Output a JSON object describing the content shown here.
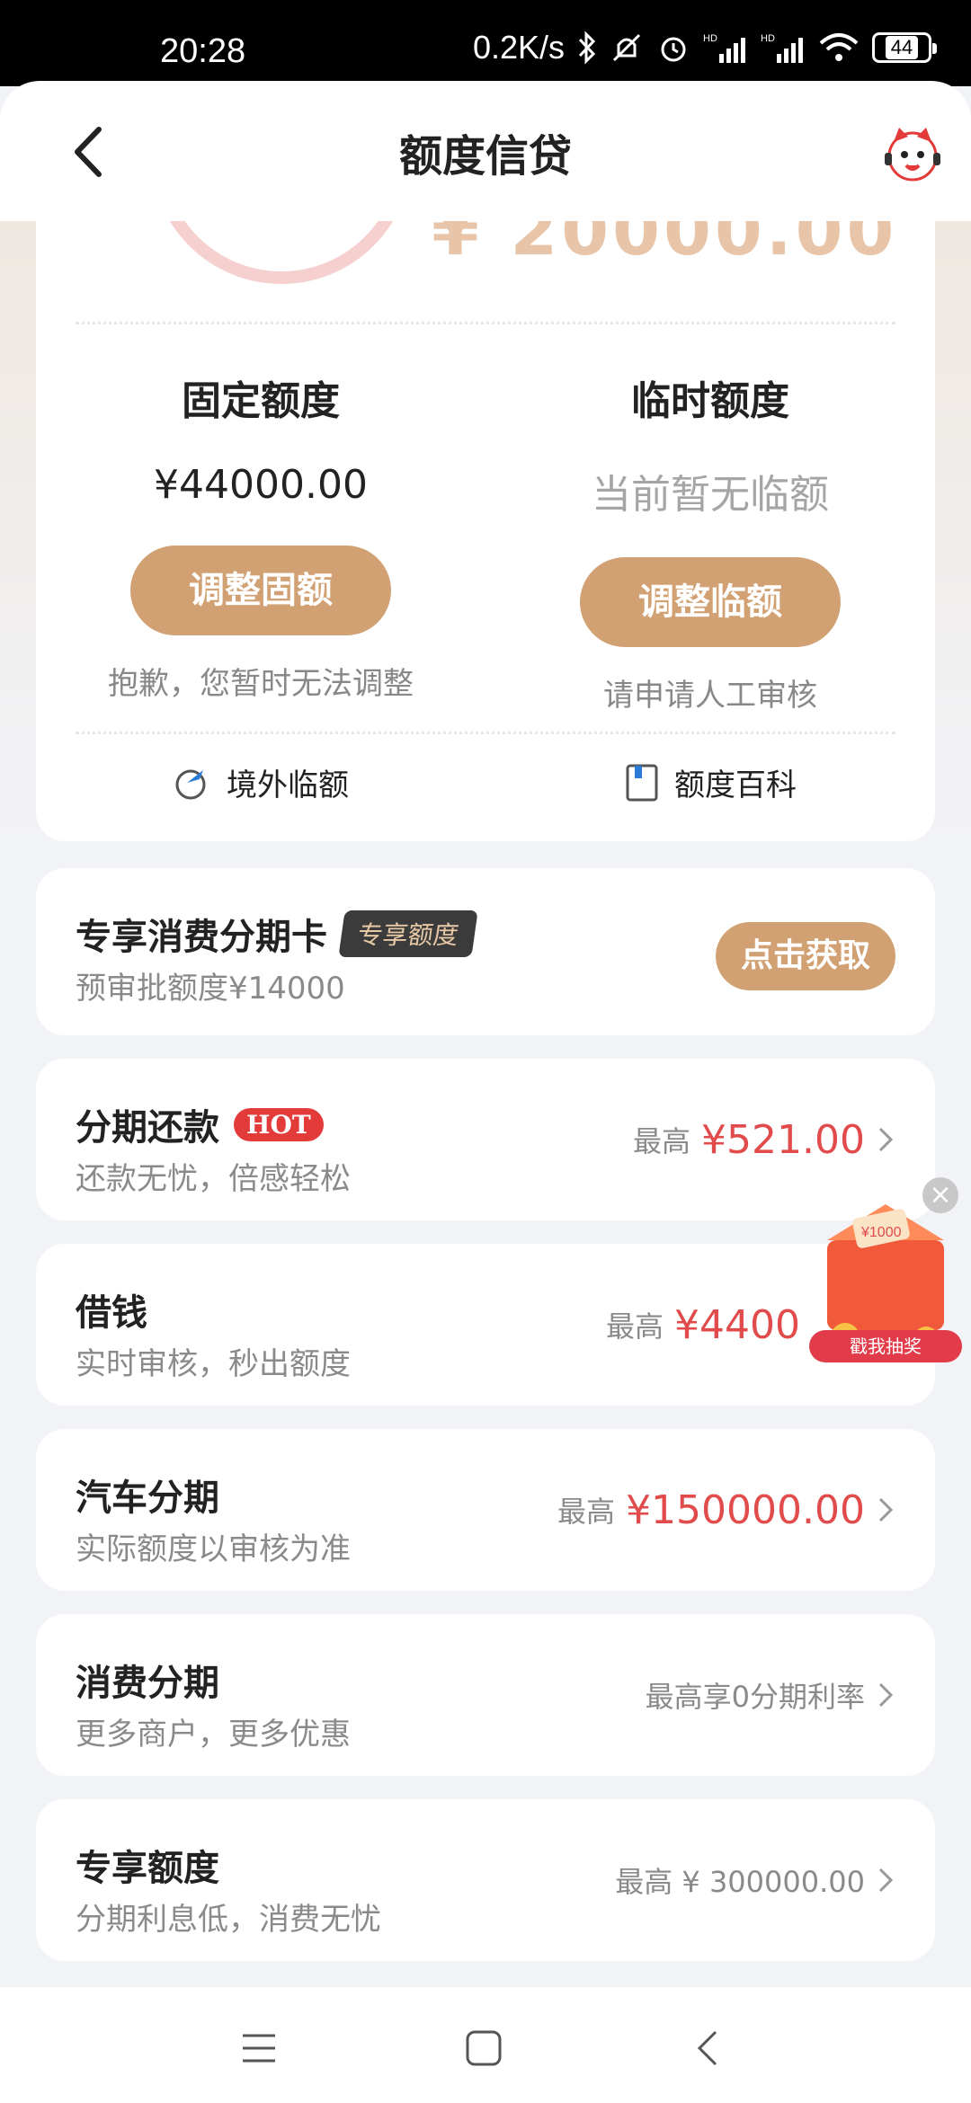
{
  "status_bar": {
    "time": "20:28",
    "speed": "0.2K/s",
    "battery": "44"
  },
  "header": {
    "title": "额度信贷"
  },
  "limits": {
    "fixed": {
      "title": "固定额度",
      "value": "¥44000.00",
      "button": "调整固额",
      "note": "抱歉，您暂时无法调整"
    },
    "temp": {
      "title": "临时额度",
      "value": "当前暂无临额",
      "button": "调整临额",
      "note": "请申请人工审核"
    },
    "links": {
      "overseas": "境外临额",
      "wiki": "额度百科"
    }
  },
  "promo": {
    "title": "专享消费分期卡",
    "badge": "专享额度",
    "sub": "预审批额度¥14000",
    "button": "点击获取"
  },
  "items": [
    {
      "title": "分期还款",
      "badge": "HOT",
      "sub": "还款无忧，倍感轻松",
      "prefix": "最高",
      "price": "¥521.00"
    },
    {
      "title": "借钱",
      "sub": "实时审核，秒出额度",
      "prefix": "最高",
      "price": "¥4400"
    },
    {
      "title": "汽车分期",
      "sub": "实际额度以审核为准",
      "prefix": "最高",
      "price": "¥150000.00"
    },
    {
      "title": "消费分期",
      "sub": "更多商户，更多优惠",
      "right_text": "最高享0分期利率"
    },
    {
      "title": "专享额度",
      "sub": "分期利息低，消费无忧",
      "right_text": "最高 ¥ 300000.00"
    }
  ],
  "float_ad": {
    "label": "戳我抽奖",
    "amount": "¥1000"
  },
  "colors": {
    "accent": "#d2a173",
    "price": "#e14b4b"
  }
}
